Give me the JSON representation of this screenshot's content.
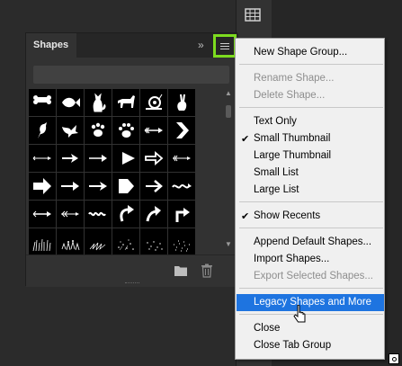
{
  "panel": {
    "tab_label": "Shapes",
    "collapse_glyph": "»",
    "search_placeholder": ""
  },
  "shapes": [
    "bone",
    "fish",
    "cat",
    "dog",
    "snail",
    "rabbit",
    "bird",
    "dove",
    "paw-print-dog",
    "paw-print-cat",
    "arrow-feathered",
    "chevron-arrow",
    "thin-arrow",
    "arrow-bold-thin",
    "arrow-line",
    "triangle-arrow",
    "arrow-outline",
    "feather-arrow",
    "block-arrow",
    "arrow-tapered",
    "arrow-barbed",
    "pentagon-arrow",
    "arrow-simple",
    "wave-arrow",
    "double-arrow",
    "feathered-arrow-2",
    "wavy-arrow",
    "curved-arrow",
    "curved-arrow-left",
    "turn-arrow",
    "grass",
    "flowers",
    "scribble",
    "scatter",
    "dots",
    "noise"
  ],
  "menu": {
    "items": [
      {
        "label": "New Shape Group...",
        "state": "enabled"
      },
      {
        "label": "Rename Shape...",
        "state": "disabled"
      },
      {
        "label": "Delete Shape...",
        "state": "disabled"
      },
      {
        "label": "Text Only",
        "state": "enabled"
      },
      {
        "label": "Small Thumbnail",
        "state": "checked"
      },
      {
        "label": "Large Thumbnail",
        "state": "enabled"
      },
      {
        "label": "Small List",
        "state": "enabled"
      },
      {
        "label": "Large List",
        "state": "enabled"
      },
      {
        "label": "Show Recents",
        "state": "checked"
      },
      {
        "label": "Append Default Shapes...",
        "state": "enabled"
      },
      {
        "label": "Import Shapes...",
        "state": "enabled"
      },
      {
        "label": "Export Selected Shapes...",
        "state": "disabled"
      },
      {
        "label": "Legacy Shapes and More",
        "state": "highlighted"
      },
      {
        "label": "Close",
        "state": "enabled"
      },
      {
        "label": "Close Tab Group",
        "state": "enabled"
      }
    ]
  },
  "colors": {
    "highlight": "#1e74e0",
    "focus_ring": "#7ddc1f",
    "panel_bg": "#323232"
  }
}
